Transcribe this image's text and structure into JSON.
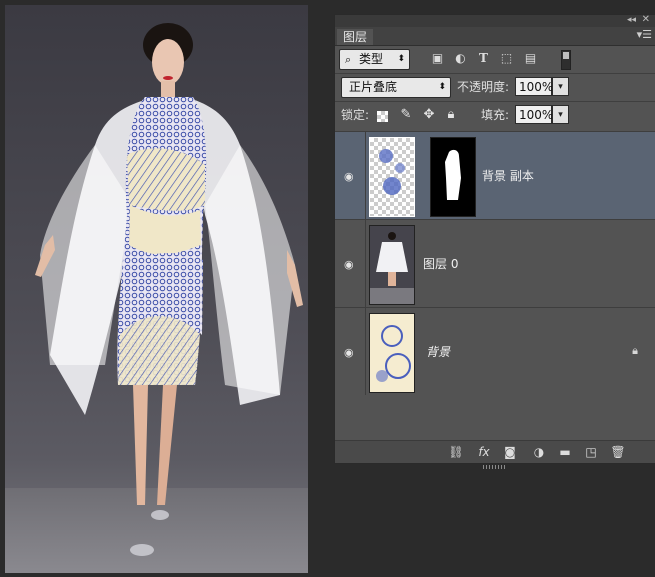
{
  "panel": {
    "tab_label": "图层",
    "collapse_glyph": "◂◂",
    "close_glyph": "✕",
    "menu_glyph": "▾☰",
    "filter": {
      "label": "类型",
      "icons": [
        "image-filter-icon",
        "adjustment-filter-icon",
        "type-filter-icon",
        "shape-filter-icon",
        "smart-object-filter-icon"
      ]
    },
    "blend_mode": "正片叠底",
    "opacity_label": "不透明度:",
    "opacity_value": "100%",
    "lock_label": "锁定:",
    "fill_label": "填充:",
    "fill_value": "100%",
    "layers": [
      {
        "name": "背景 副本",
        "selected": true,
        "visible": true,
        "has_mask": true,
        "locked": false
      },
      {
        "name": "图层 0",
        "selected": false,
        "visible": true,
        "has_mask": false,
        "locked": false
      },
      {
        "name": "背景",
        "selected": false,
        "visible": true,
        "has_mask": false,
        "locked": true
      }
    ],
    "bottom_icons": [
      "link-layers-icon",
      "fx-icon",
      "add-mask-icon",
      "adjustment-layer-icon",
      "new-group-icon",
      "new-layer-icon",
      "delete-layer-icon"
    ]
  },
  "colors": {
    "panel_bg": "#535353",
    "selected_layer": "#5a6473",
    "canvas_bg": "#3b3a42"
  }
}
